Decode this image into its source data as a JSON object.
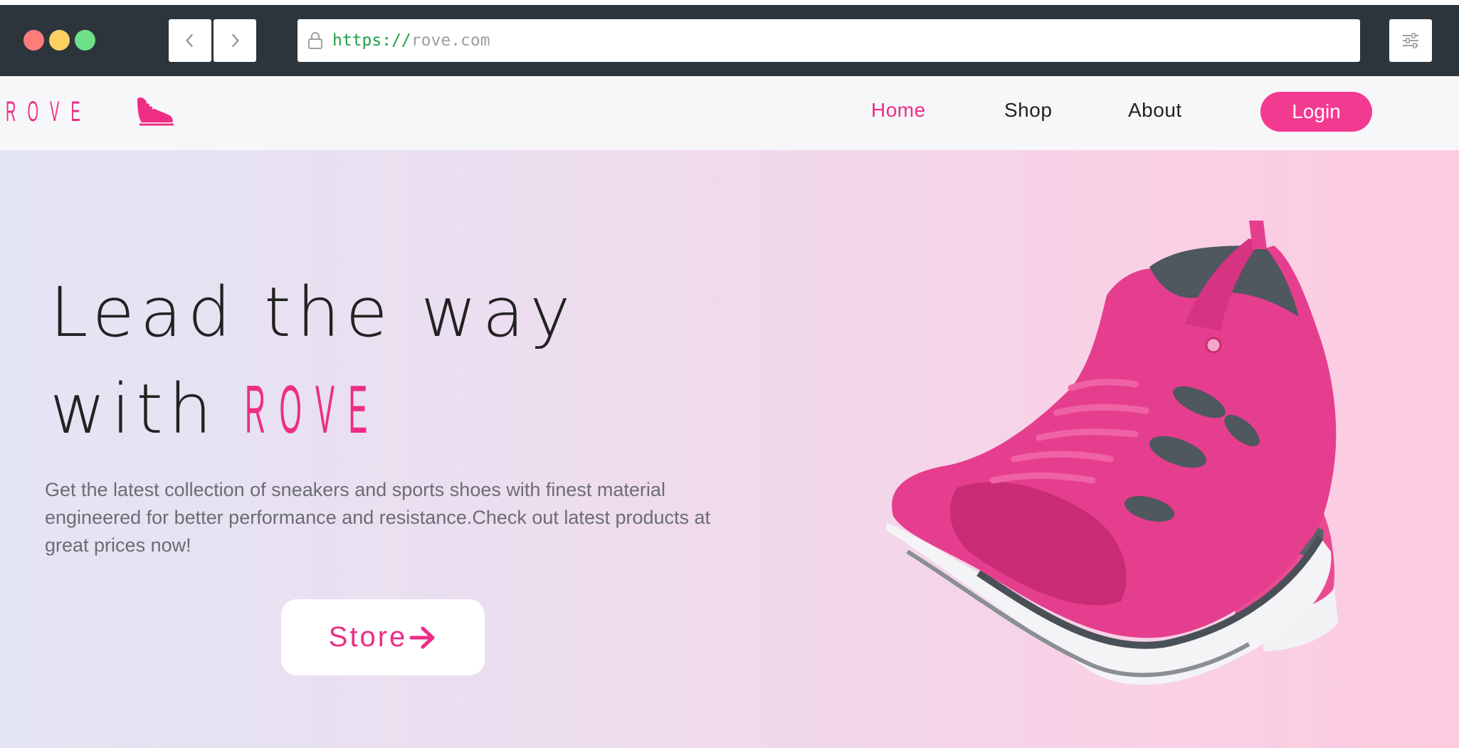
{
  "browser": {
    "url_scheme": "https://",
    "url_host": "rove.com",
    "traffic_lights": [
      "#ff7c7c",
      "#ffd061",
      "#6fe08a"
    ]
  },
  "header": {
    "logo_text": "ROVE",
    "nav": [
      {
        "label": "Home",
        "active": true
      },
      {
        "label": "Shop",
        "active": false
      },
      {
        "label": "About",
        "active": false
      }
    ],
    "login_label": "Login"
  },
  "hero": {
    "headline_line1": "Lead the way",
    "headline_with": "with",
    "headline_brand": "ROVE",
    "description": "Get the latest collection of sneakers and sports shoes with finest material engineered for better performance and resistance.Check out latest products at great prices now!",
    "store_label": "Store",
    "image_icon": "pink-sneakers-image"
  },
  "colors": {
    "accent": "#ee2d85",
    "login_bg": "#f33a91",
    "chrome_bg": "#2d353c"
  }
}
